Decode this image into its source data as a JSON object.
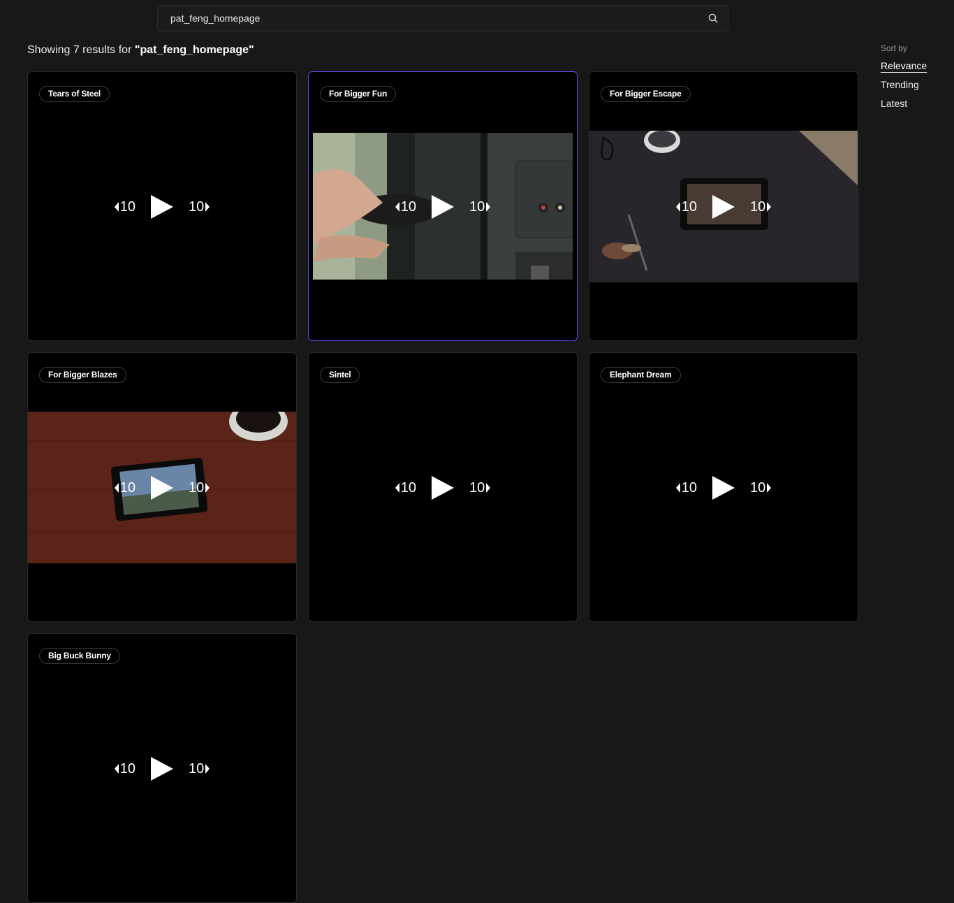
{
  "search": {
    "value": "pat_feng_homepage",
    "icon": "search-icon"
  },
  "results": {
    "prefix": "Showing 7 results for ",
    "query": "\"pat_feng_homepage\""
  },
  "sort": {
    "title": "Sort by",
    "options": [
      "Relevance",
      "Trending",
      "Latest"
    ],
    "selected": "Relevance"
  },
  "controls": {
    "rewind_label": "10",
    "forward_label": "10"
  },
  "videos": [
    {
      "title": "Tears of Steel"
    },
    {
      "title": "For Bigger Fun",
      "selected": true
    },
    {
      "title": "For Bigger Escape"
    },
    {
      "title": "For Bigger Blazes"
    },
    {
      "title": "Sintel"
    },
    {
      "title": "Elephant Dream"
    },
    {
      "title": "Big Buck Bunny"
    }
  ],
  "colors": {
    "background": "#181818",
    "card": "#000000",
    "selected_border": "#5b4ee8"
  }
}
